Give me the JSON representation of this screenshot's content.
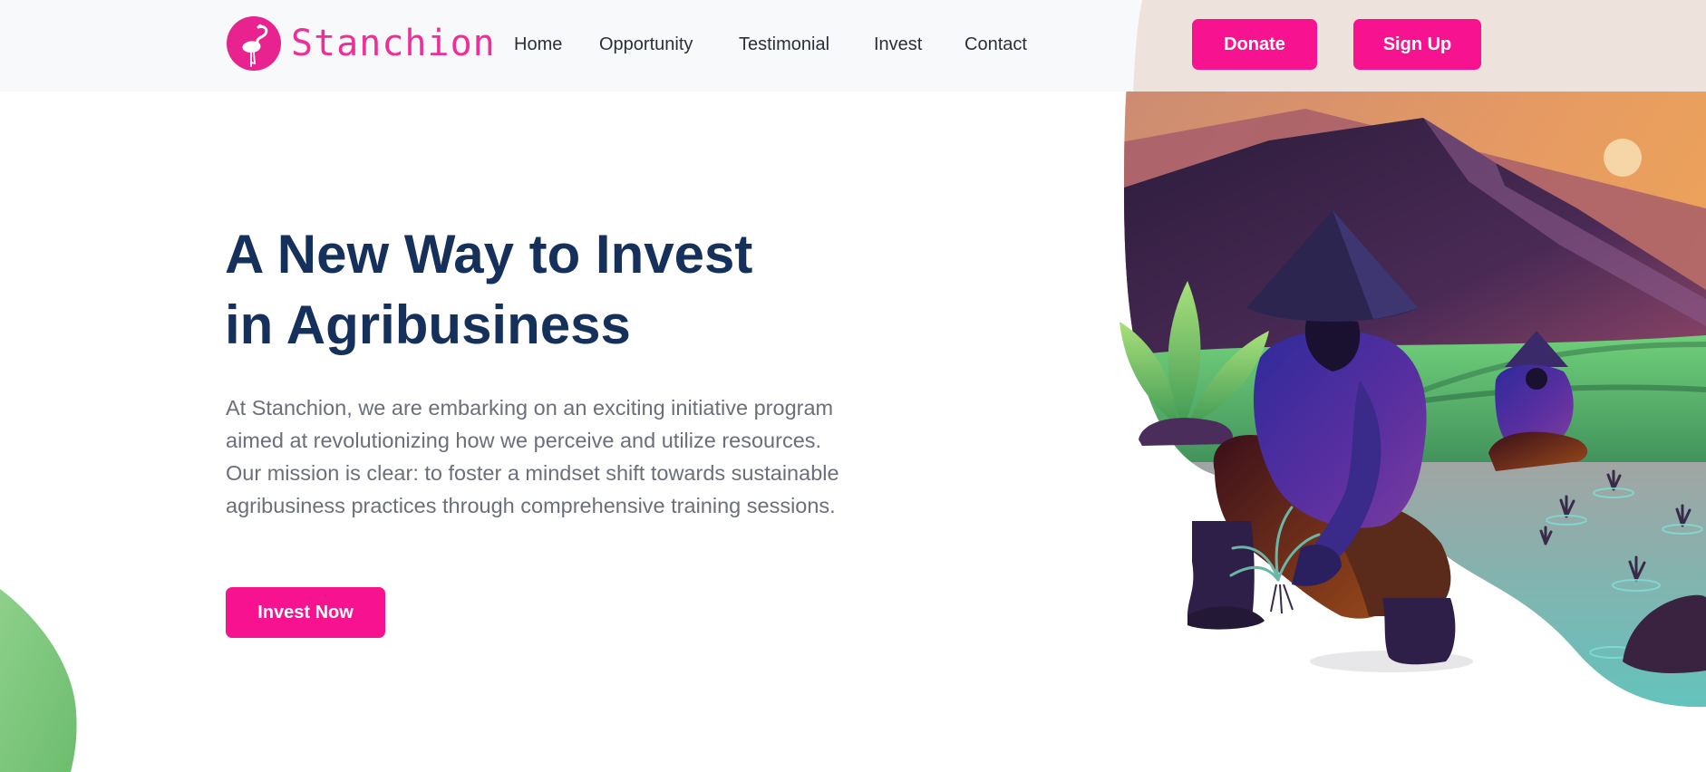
{
  "header": {
    "brand": "Stanchion",
    "logo_icon": "flamingo-icon",
    "nav": [
      "Home",
      "Opportunity",
      "Testimonial",
      "Invest",
      "Contact"
    ],
    "donate_label": "Donate",
    "signup_label": "Sign Up"
  },
  "hero": {
    "title_line1": "A New Way to Invest",
    "title_line2": "in Agribusiness",
    "description": "At Stanchion, we are embarking on an exciting initiative program aimed at revolutionizing how we perceive and utilize resources. Our mission is clear: to foster a mindset shift towards sustainable agribusiness practices through comprehensive training sessions.",
    "cta_label": "Invest Now",
    "illustration_icon": "farmers-planting-rice-illustration"
  },
  "colors": {
    "accent": "#f7138f",
    "heading": "#15305a",
    "body_text": "#6b6e7b",
    "header_bg": "#f8f9fb",
    "leaf_green": "#7cc77c"
  }
}
